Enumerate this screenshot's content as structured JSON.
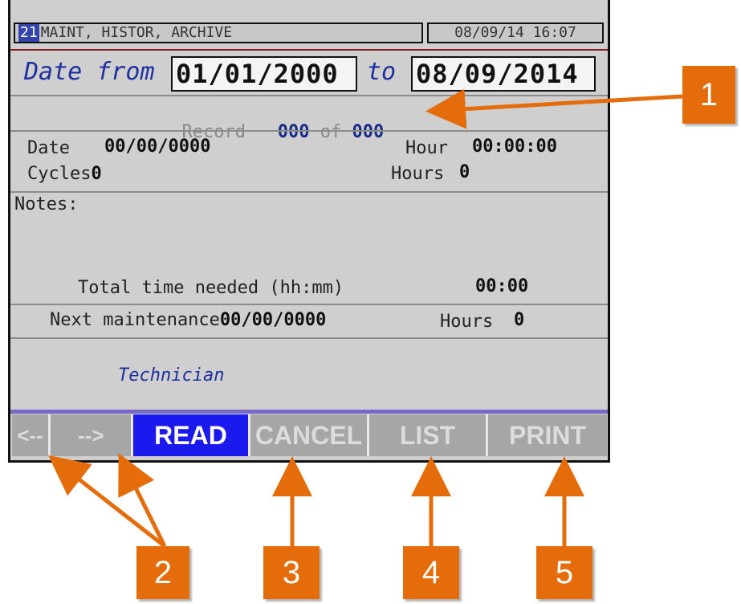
{
  "header": {
    "screen_number": "21",
    "title": "MAINT, HISTOR, ARCHIVE",
    "datetime": "08/09/14  16:07"
  },
  "date_range": {
    "from_label": "Date from",
    "from_value": "01/01/2000",
    "to_label": "to",
    "to_value": "08/09/2014"
  },
  "record": {
    "label": "Record",
    "current": "000",
    "of_label": "of",
    "total": "000"
  },
  "details": {
    "date_label": "Date",
    "date_value": "00/00/0000",
    "hour_label": "Hour",
    "hour_value": "00:00:00",
    "cycles_label": "Cycles",
    "cycles_value": "0",
    "hours_label": "Hours",
    "hours_value": "0",
    "notes_label": "Notes:",
    "total_time_label": "Total time needed (hh:mm)",
    "total_time_value": "00:00",
    "next_maint_label": "Next maintenance",
    "next_maint_value": "00/00/0000",
    "next_hours_label": "Hours",
    "next_hours_value": "0",
    "technician_label": "Technician"
  },
  "softkeys": {
    "prev": "<--",
    "next": "-->",
    "read": "READ",
    "cancel": "CANCEL",
    "list": "LIST",
    "print": "PRINT"
  },
  "callouts": {
    "c1": "1",
    "c2": "2",
    "c3": "3",
    "c4": "4",
    "c5": "5"
  },
  "colors": {
    "callout": "#e46c0a",
    "active_key": "#1a1aee",
    "panel_bg": "#cfcfcf",
    "record_value": "#1a2a88"
  }
}
